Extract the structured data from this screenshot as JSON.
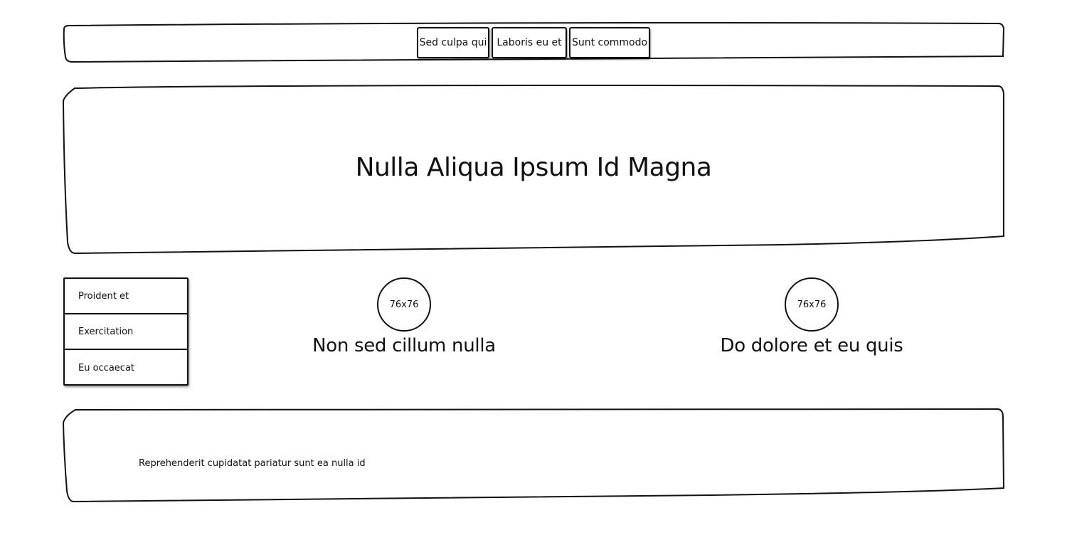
{
  "nav": {
    "items": [
      {
        "label": "Sed culpa qui"
      },
      {
        "label": "Laboris eu et"
      },
      {
        "label": "Sunt commodo"
      }
    ]
  },
  "hero": {
    "title": "Nulla Aliqua Ipsum Id Magna"
  },
  "sidebar": {
    "items": [
      {
        "label": "Proident et"
      },
      {
        "label": "Exercitation"
      },
      {
        "label": "Eu occaecat"
      }
    ]
  },
  "features": [
    {
      "image_placeholder": "76x76",
      "title": "Non sed cillum nulla"
    },
    {
      "image_placeholder": "76x76",
      "title": "Do dolore et eu quis"
    }
  ],
  "footer": {
    "text": "Reprehenderit cupidatat pariatur sunt ea nulla id"
  },
  "colors": {
    "stroke": "#111111",
    "background": "#ffffff"
  }
}
